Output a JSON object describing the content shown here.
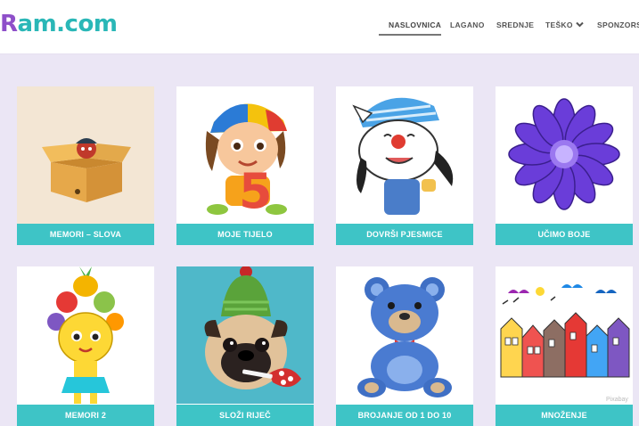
{
  "brand": {
    "logo_initial": "R",
    "logo_rest": "am.com"
  },
  "nav": {
    "items": [
      "NASLOVNICA",
      "LAGANO",
      "SREDNJE",
      "TEŠKO",
      "SPONZORST"
    ],
    "active": "NASLOVNICA"
  },
  "cards": [
    {
      "label": "MEMORI – SLOVA",
      "icon": "box-icon"
    },
    {
      "label": "MOJE TIJELO",
      "icon": "child-icon"
    },
    {
      "label": "DOVRŠI PJESMICE",
      "icon": "cartoon-dog-icon"
    },
    {
      "label": "UČIMO BOJE",
      "icon": "purple-flower-icon"
    },
    {
      "label": "MEMORI 2",
      "icon": "fruit-girl-icon"
    },
    {
      "label": "SLOŽI RIJEČ",
      "icon": "pug-icon"
    },
    {
      "label": "BROJANJE OD 1 DO 10",
      "icon": "teddy-bear-icon"
    },
    {
      "label": "MNOŽENJE",
      "icon": "houses-icon"
    }
  ],
  "colors": {
    "accent": "#3ec4c6",
    "logo_purple": "#8e4fc9",
    "logo_teal": "#2ab7b7",
    "background": "#ebe6f5"
  }
}
